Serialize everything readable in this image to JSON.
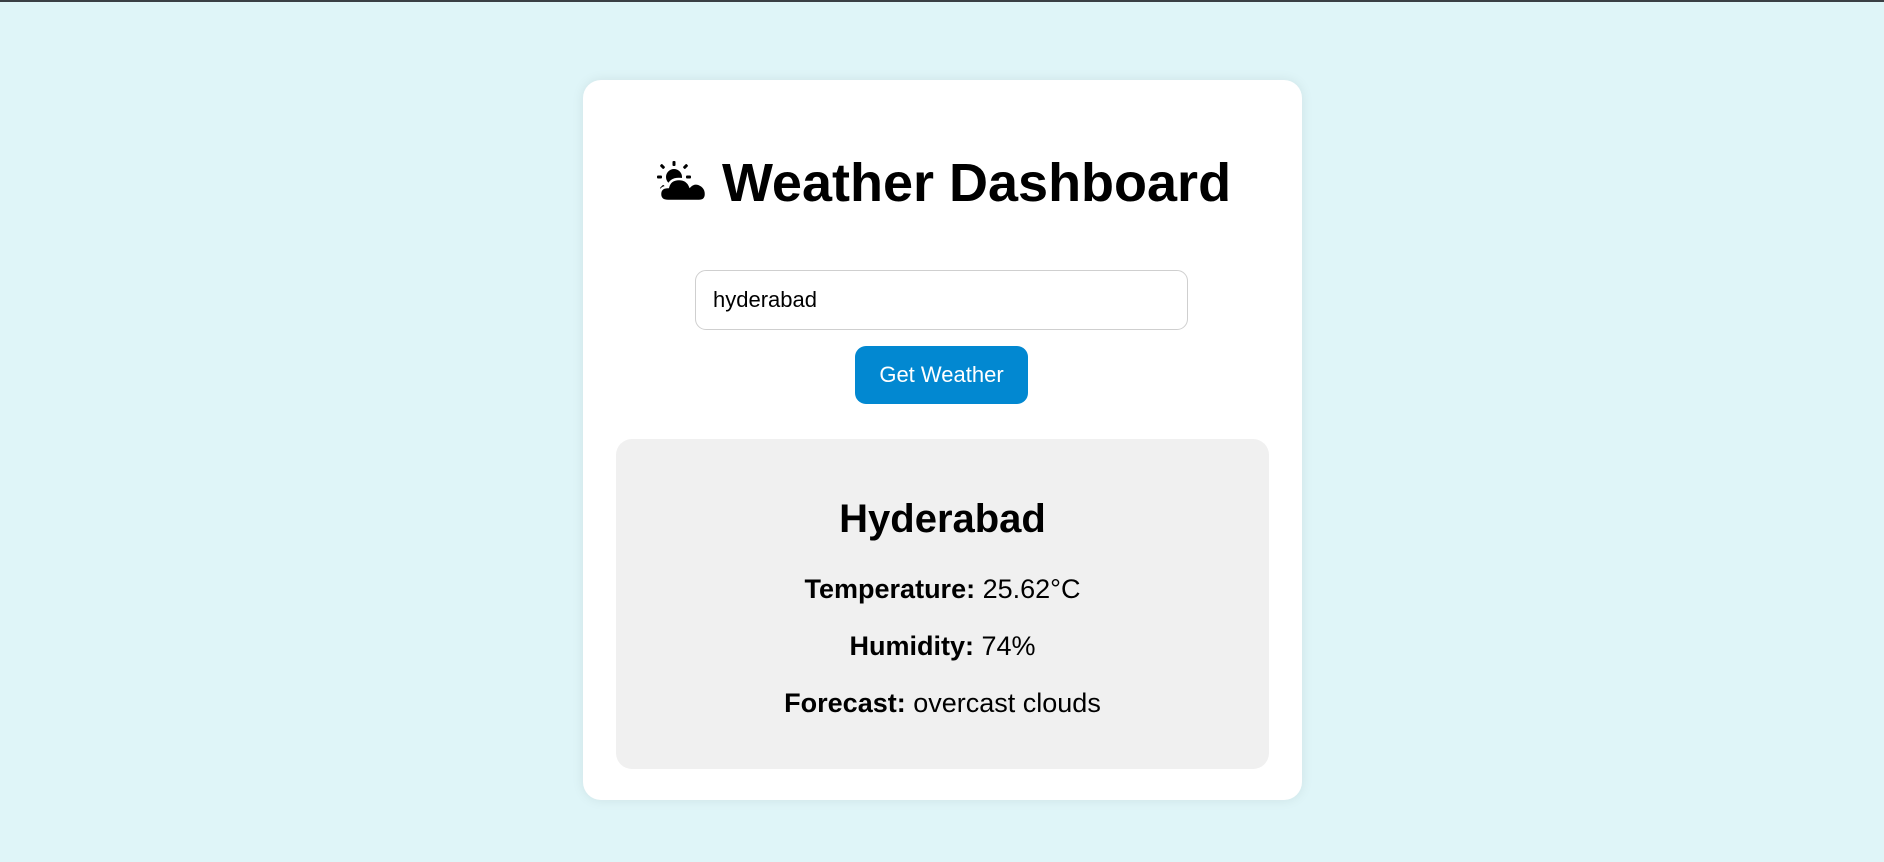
{
  "page": {
    "title": "Weather Dashboard",
    "title_icon": "sun-behind-cloud-icon"
  },
  "search": {
    "value": "hyderabad",
    "button_label": "Get Weather"
  },
  "result": {
    "city": "Hyderabad",
    "temperature_label": "Temperature:",
    "temperature_value": "25.62°C",
    "humidity_label": "Humidity:",
    "humidity_value": "74%",
    "forecast_label": "Forecast:",
    "forecast_value": "overcast clouds"
  },
  "colors": {
    "background": "#dff5f8",
    "button": "#0288d1",
    "result_panel": "#f0f0f0"
  }
}
